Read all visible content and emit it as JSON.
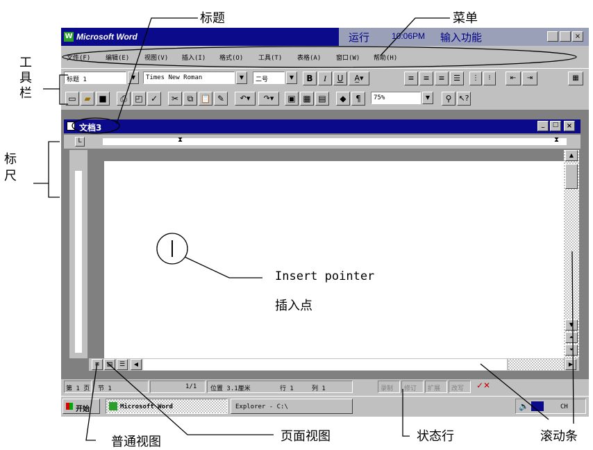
{
  "app": {
    "title": "Microsoft Word",
    "tray_run": "运行",
    "tray_time": "10:06PM",
    "tray_ime": "输入功能"
  },
  "menu": [
    "文件(F)",
    "编辑(E)",
    "视图(V)",
    "插入(I)",
    "格式(O)",
    "工具(T)",
    "表格(A)",
    "窗口(W)",
    "帮助(H)"
  ],
  "toolbar": {
    "style_value": "标题 1",
    "font_value": "Times New Roman",
    "size_value": "二号",
    "bold": "B",
    "italic": "I",
    "underline": "U",
    "zoom_value": "75%"
  },
  "document": {
    "title": "文档3",
    "cursor_glyph": "I"
  },
  "status": {
    "page": "第 1 页",
    "section": "节 1",
    "pages": "1/1",
    "position": "位置 3.1厘米",
    "line": "行 1",
    "column": "列 1",
    "indicators": [
      "录制",
      "修订",
      "扩展",
      "改写"
    ]
  },
  "taskbar": {
    "start": "开始",
    "task1": "Microsoft Word",
    "task2": "Explorer - C:\\",
    "clock": "CH"
  },
  "annotations": {
    "title": "标题",
    "menu": "菜单",
    "toolbar": "工具栏",
    "ruler": "标尺",
    "insert_pointer_en": "Insert pointer",
    "insert_pointer_cn": "插入点",
    "normal_view": "普通视图",
    "page_view": "页面视图",
    "status_bar": "状态行",
    "scrollbar": "滚动条"
  },
  "colors": {
    "titlebar": "#0a0a8a",
    "window_gray": "#c0c0c0",
    "workspace": "#808080"
  }
}
